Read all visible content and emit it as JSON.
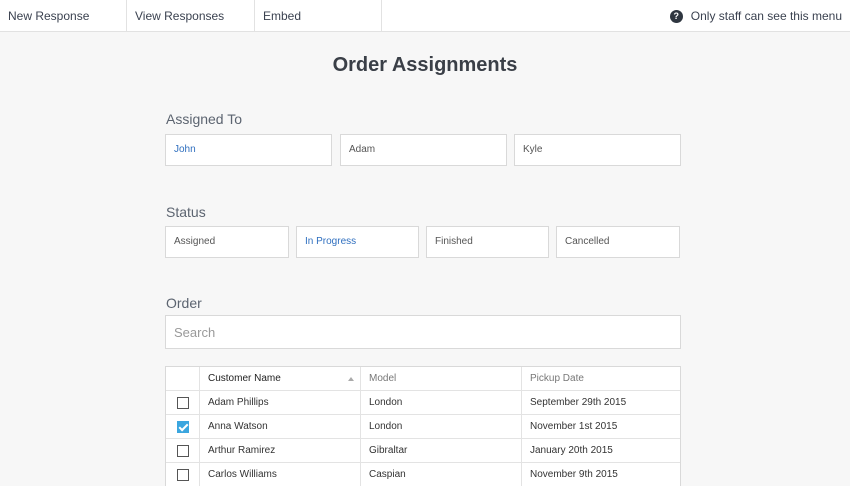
{
  "topbar": {
    "tabs": [
      {
        "label": "New Response"
      },
      {
        "label": "View Responses"
      },
      {
        "label": "Embed"
      }
    ],
    "staff_notice": "Only staff can see this menu"
  },
  "page": {
    "title": "Order Assignments"
  },
  "assigned": {
    "label": "Assigned To",
    "options": [
      {
        "label": "John",
        "selected": true
      },
      {
        "label": "Adam",
        "selected": false
      },
      {
        "label": "Kyle",
        "selected": false
      }
    ]
  },
  "status": {
    "label": "Status",
    "options": [
      {
        "label": "Assigned",
        "selected": false
      },
      {
        "label": "In Progress",
        "selected": true
      },
      {
        "label": "Finished",
        "selected": false
      },
      {
        "label": "Cancelled",
        "selected": false
      }
    ]
  },
  "order": {
    "label": "Order",
    "search_placeholder": "Search",
    "columns": [
      "Customer Name",
      "Model",
      "Pickup Date"
    ],
    "rows": [
      {
        "checked": false,
        "name": "Adam Phillips",
        "model": "London",
        "date": "September 29th 2015"
      },
      {
        "checked": true,
        "name": "Anna Watson",
        "model": "London",
        "date": "November 1st 2015"
      },
      {
        "checked": false,
        "name": "Arthur Ramirez",
        "model": "Gibraltar",
        "date": "January 20th 2015"
      },
      {
        "checked": false,
        "name": "Carlos Williams",
        "model": "Caspian",
        "date": "November 9th 2015"
      }
    ]
  },
  "colors": {
    "accent": "#2f6fbf",
    "checkbox": "#3ba6df"
  }
}
